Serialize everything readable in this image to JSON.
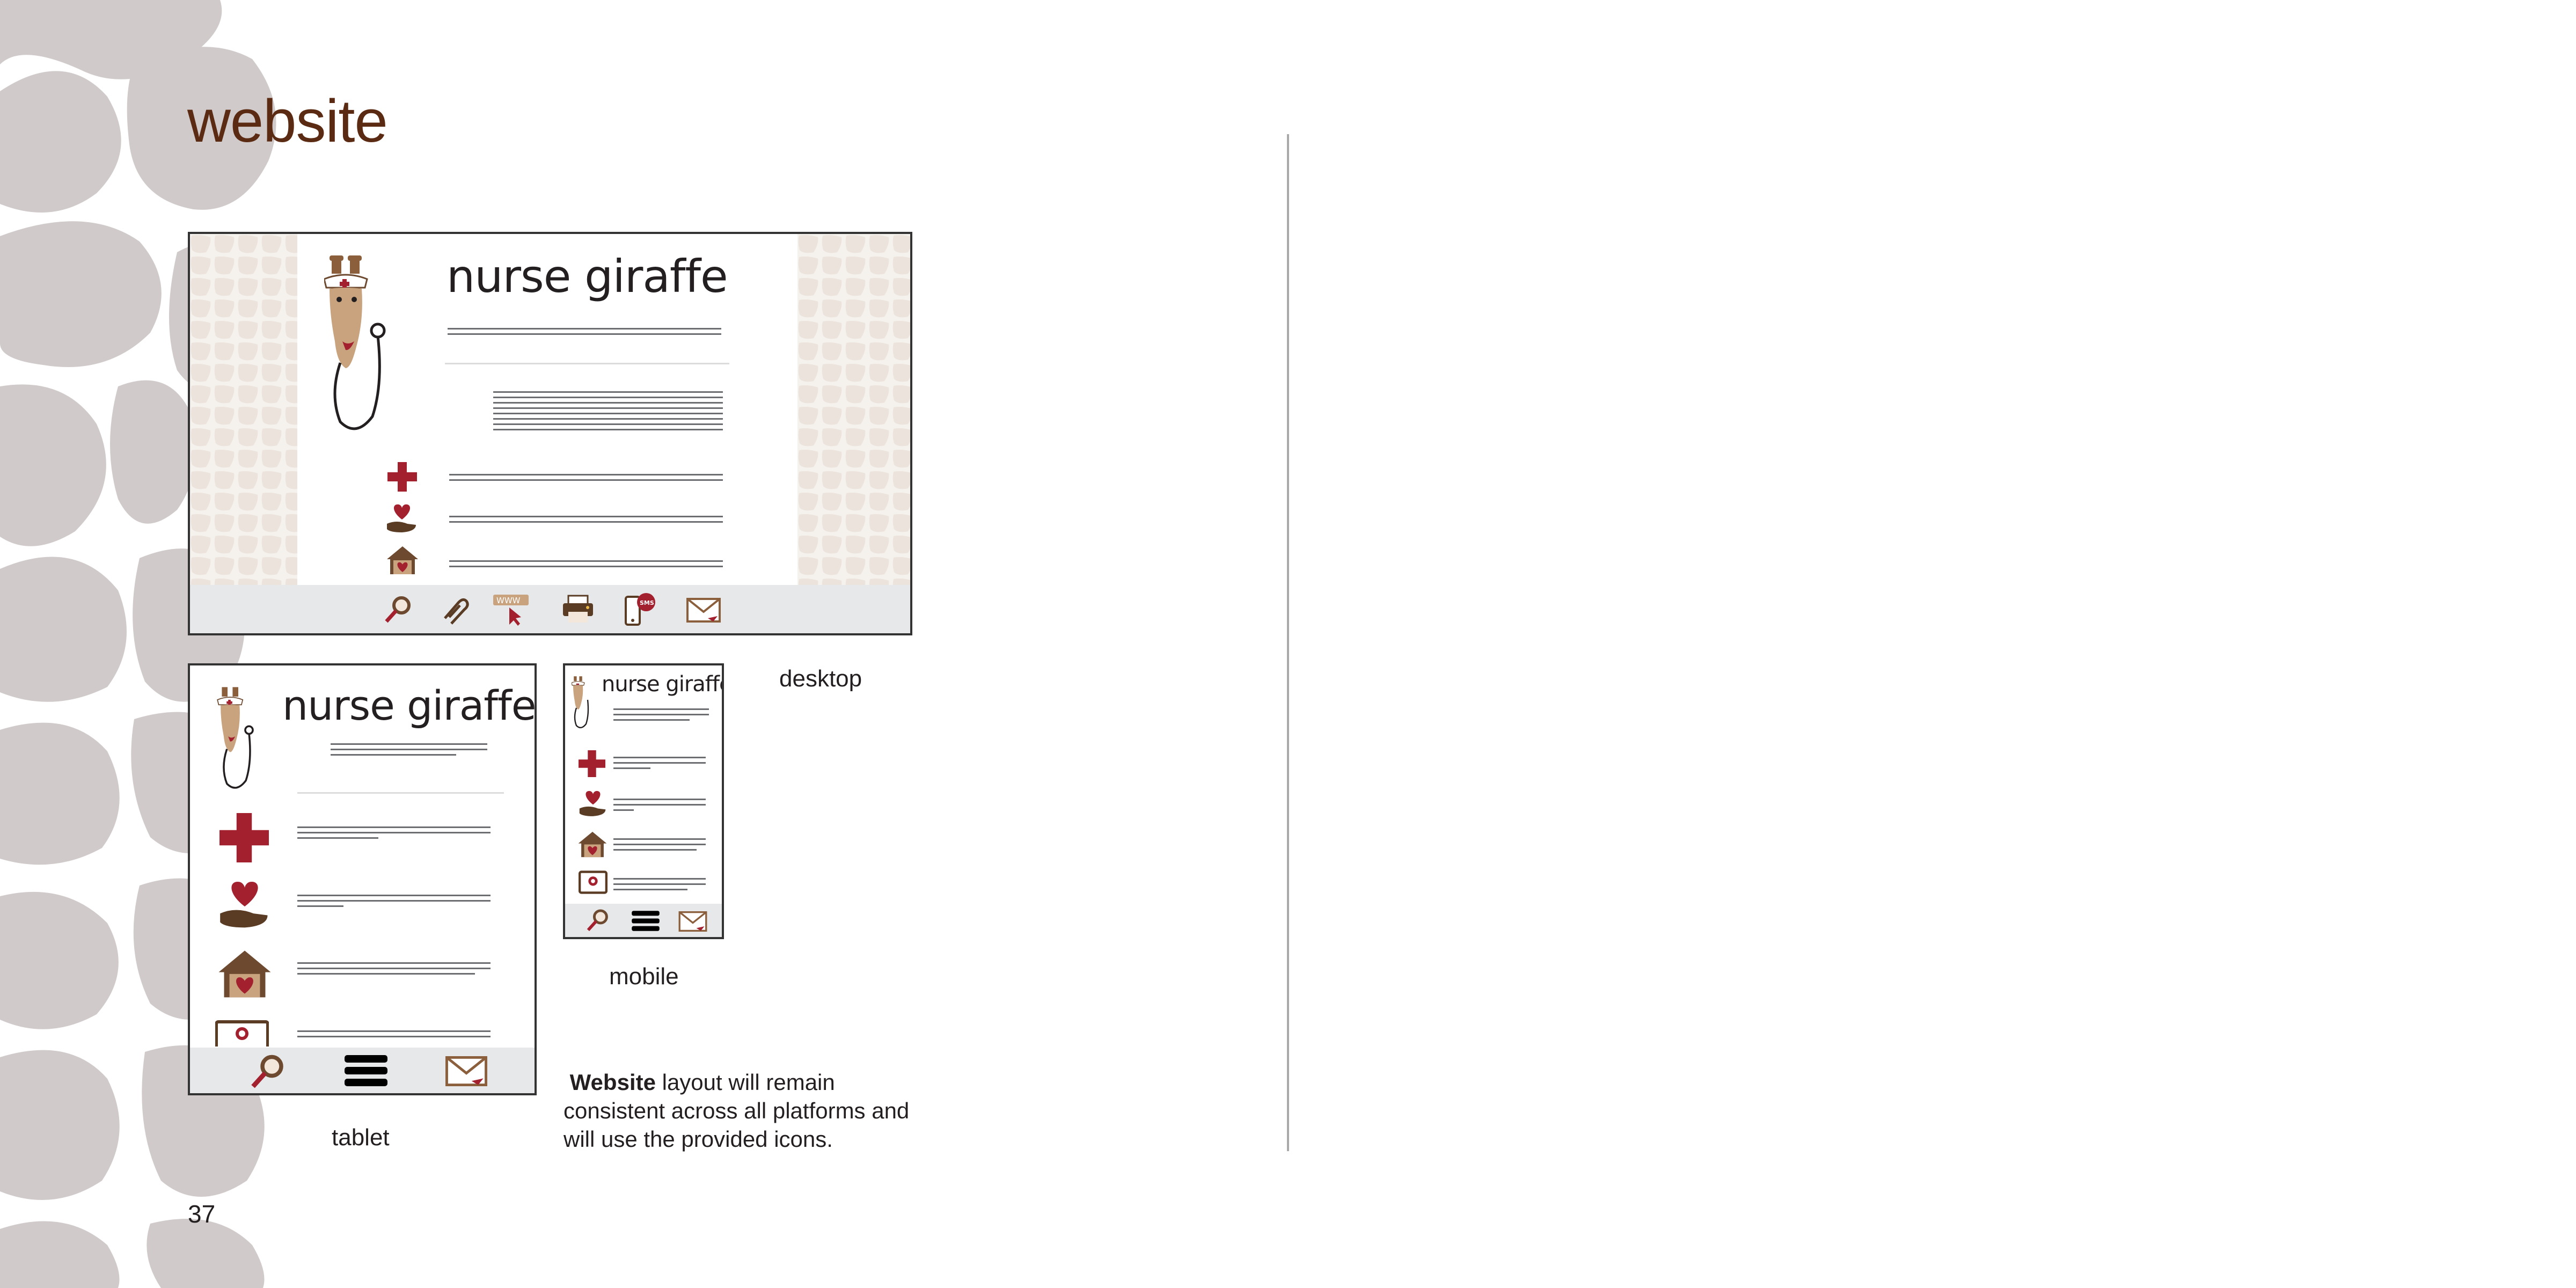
{
  "page": {
    "title": "website",
    "page_number": "37"
  },
  "mockups": {
    "desktop": {
      "brand": "nurse giraffe",
      "caption": "desktop"
    },
    "tablet": {
      "brand": "nurse giraffe",
      "caption": "tablet"
    },
    "mobile": {
      "brand": "nurse giraffe",
      "caption": "mobile"
    }
  },
  "description": {
    "bold": "Website",
    "rest": " layout will remain consistent across all platforms and will use the provided icons."
  },
  "icons": {
    "desktop_sections": [
      "cross-icon",
      "heart-hand-icon",
      "house-heart-icon"
    ],
    "desktop_footer": [
      "magnifier-icon",
      "paperclip-icon",
      "www-cursor-icon",
      "printer-icon",
      "phone-sms-icon",
      "envelope-icon"
    ],
    "tablet_sections": [
      "cross-icon",
      "heart-hand-icon",
      "house-heart-icon",
      "certificate-icon"
    ],
    "tablet_footer": [
      "magnifier-icon",
      "menu-icon",
      "envelope-icon"
    ]
  },
  "colors": {
    "title_brown": "#5b2a12",
    "spot_gray": "#d0caca",
    "accent_red": "#a3202f",
    "dark_brown": "#5a3b24",
    "footer_bar": "#e7e8e9"
  }
}
